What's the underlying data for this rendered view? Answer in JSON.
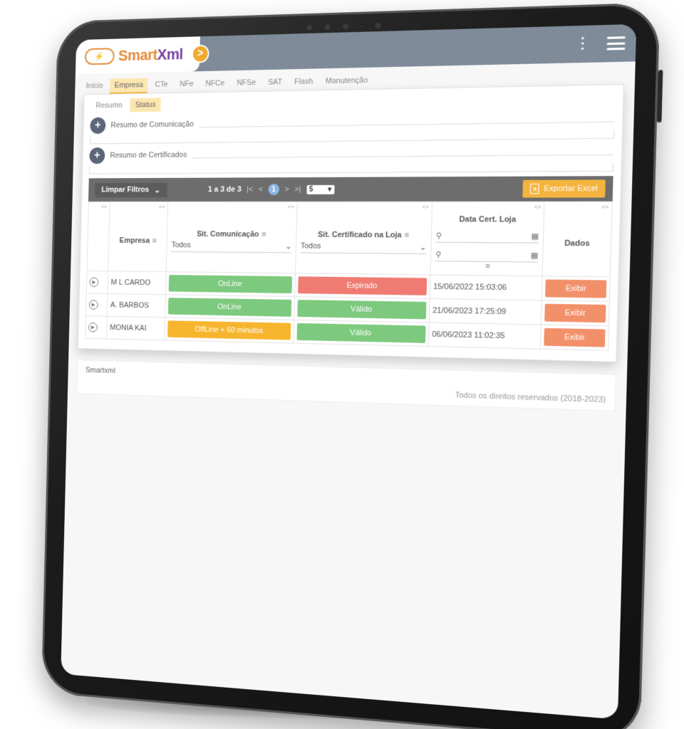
{
  "header": {
    "logo_text_a": "Smart",
    "logo_text_b": "Xml",
    "toggle": ">",
    "menu_kebab": "⋮"
  },
  "main_tabs": [
    "Início",
    "Empresa",
    "CTe",
    "NFe",
    "NFCe",
    "NFSe",
    "SAT",
    "Flash",
    "Manutenção"
  ],
  "sub_tabs": [
    "Resumo",
    "Status"
  ],
  "sections": {
    "comunicacao": "Resumo de Comunicação",
    "certificados": "Resumo de Certificados"
  },
  "toolbar": {
    "clear_filters": "Limpar Filtros",
    "paging_text": "1 a 3 de 3",
    "current_page": "1",
    "page_size": "5",
    "export": "Exportar Excel"
  },
  "table": {
    "headers": {
      "empresa": "Empresa",
      "comunicacao": "Sit. Comunicação",
      "comunicacao_filter": "Todos",
      "certificado": "Sit. Certificado na Loja",
      "certificado_filter": "Todos",
      "data_cert": "Data Cert. Loja",
      "dados": "Dados"
    },
    "rows": [
      {
        "empresa": "M L CARDO",
        "comunicacao": "OnLine",
        "certificado": "Expirado",
        "data": "15/06/2022 15:03:06",
        "action": "Exibir"
      },
      {
        "empresa": "A. BARBOS",
        "comunicacao": "OnLine",
        "certificado": "Válido",
        "data": "21/06/2023 17:25:09",
        "action": "Exibir"
      },
      {
        "empresa": "MONIA KAI",
        "comunicacao": "OffLine + 60 minutos",
        "certificado": "Válido",
        "data": "06/06/2023 11:02:35",
        "action": "Exibir"
      }
    ]
  },
  "footer": {
    "brand": "Smartxml",
    "rights": "Todos os direitos reservados (2018-2023)"
  },
  "colors": {
    "header_bg": "#7f8b99",
    "accent_orange": "#f4b43e",
    "online_green": "#7dc97e",
    "expired_red": "#ef7b72",
    "offline_orange": "#f7b52e",
    "exibir": "#f2906a"
  }
}
